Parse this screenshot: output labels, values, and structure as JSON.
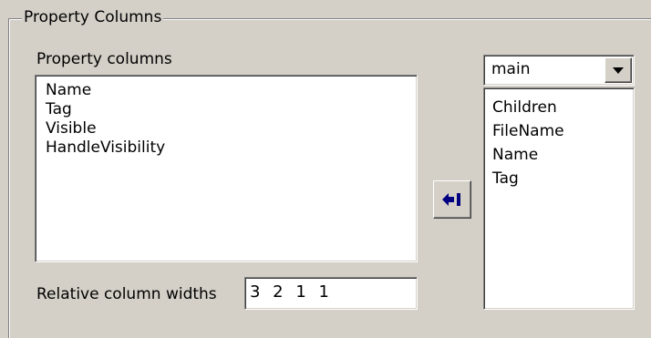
{
  "group": {
    "title": "Property Columns"
  },
  "left": {
    "label": "Property columns",
    "items": [
      "Name",
      "Tag",
      "Visible",
      "HandleVisibility"
    ]
  },
  "widths": {
    "label": "Relative column widths",
    "value": "3 2 1 1"
  },
  "right": {
    "combo_value": "main",
    "items": [
      "Children",
      "FileName",
      "Name",
      "Tag"
    ]
  },
  "icons": {
    "move_left": "arrow-left-to-bar-icon",
    "dropdown": "chevron-down-icon"
  },
  "colors": {
    "face": "#d4d0c8",
    "arrow": "#000080"
  }
}
